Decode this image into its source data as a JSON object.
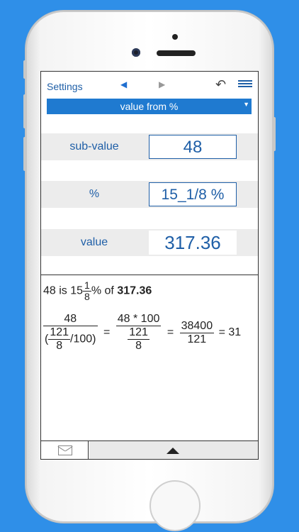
{
  "toolbar": {
    "settings_label": "Settings",
    "nav_left": "◀",
    "nav_right": "▶",
    "undo": "↶"
  },
  "mode": {
    "label": "value from %",
    "caret": "▼"
  },
  "fields": [
    {
      "label": "sub-value",
      "value": "48"
    },
    {
      "label": "%",
      "value": "15_1/8 %"
    },
    {
      "label": "value",
      "value": "317.36"
    }
  ],
  "result": {
    "prefix": "48 is 15",
    "frac_num": "1",
    "frac_den": "8",
    "mid": "% of ",
    "value": "317.36"
  },
  "equation": {
    "f1_num": "48",
    "f1_den_open": "(",
    "f1_den_num": "121",
    "f1_den_den": "8",
    "f1_den_close": "/100)",
    "eq1": "=",
    "f2_num": "48 * 100",
    "f2_den_num": "121",
    "f2_den_den": "8",
    "eq2": "=",
    "f3_num": "38400",
    "f3_den": "121",
    "tail": "= 31"
  },
  "colors": {
    "background": "#2f8fe8",
    "accent": "#1f7ad0",
    "text_blue": "#1f5fa7"
  }
}
